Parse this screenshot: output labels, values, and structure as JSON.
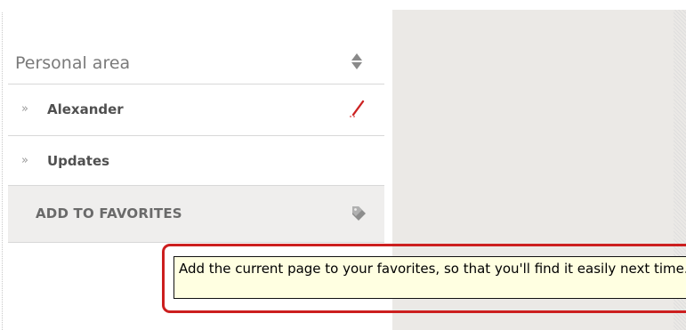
{
  "sidebar": {
    "header": "Personal area",
    "items": [
      {
        "label": "Alexander",
        "marker": "»"
      },
      {
        "label": "Updates",
        "marker": "»"
      }
    ],
    "favorite_action": {
      "label": "ADD TO FAVORITES"
    }
  },
  "tooltip": {
    "text": "Add the current page to your favorites, so that you'll find it easily next time."
  },
  "icons": {
    "sort": "sort-icon",
    "edit": "pencil-icon",
    "bookmark": "bookmark-icon"
  },
  "colors": {
    "tooltip_bg": "#ffffe1",
    "highlight": "#cc1f1f",
    "pencil": "#cc2222"
  }
}
